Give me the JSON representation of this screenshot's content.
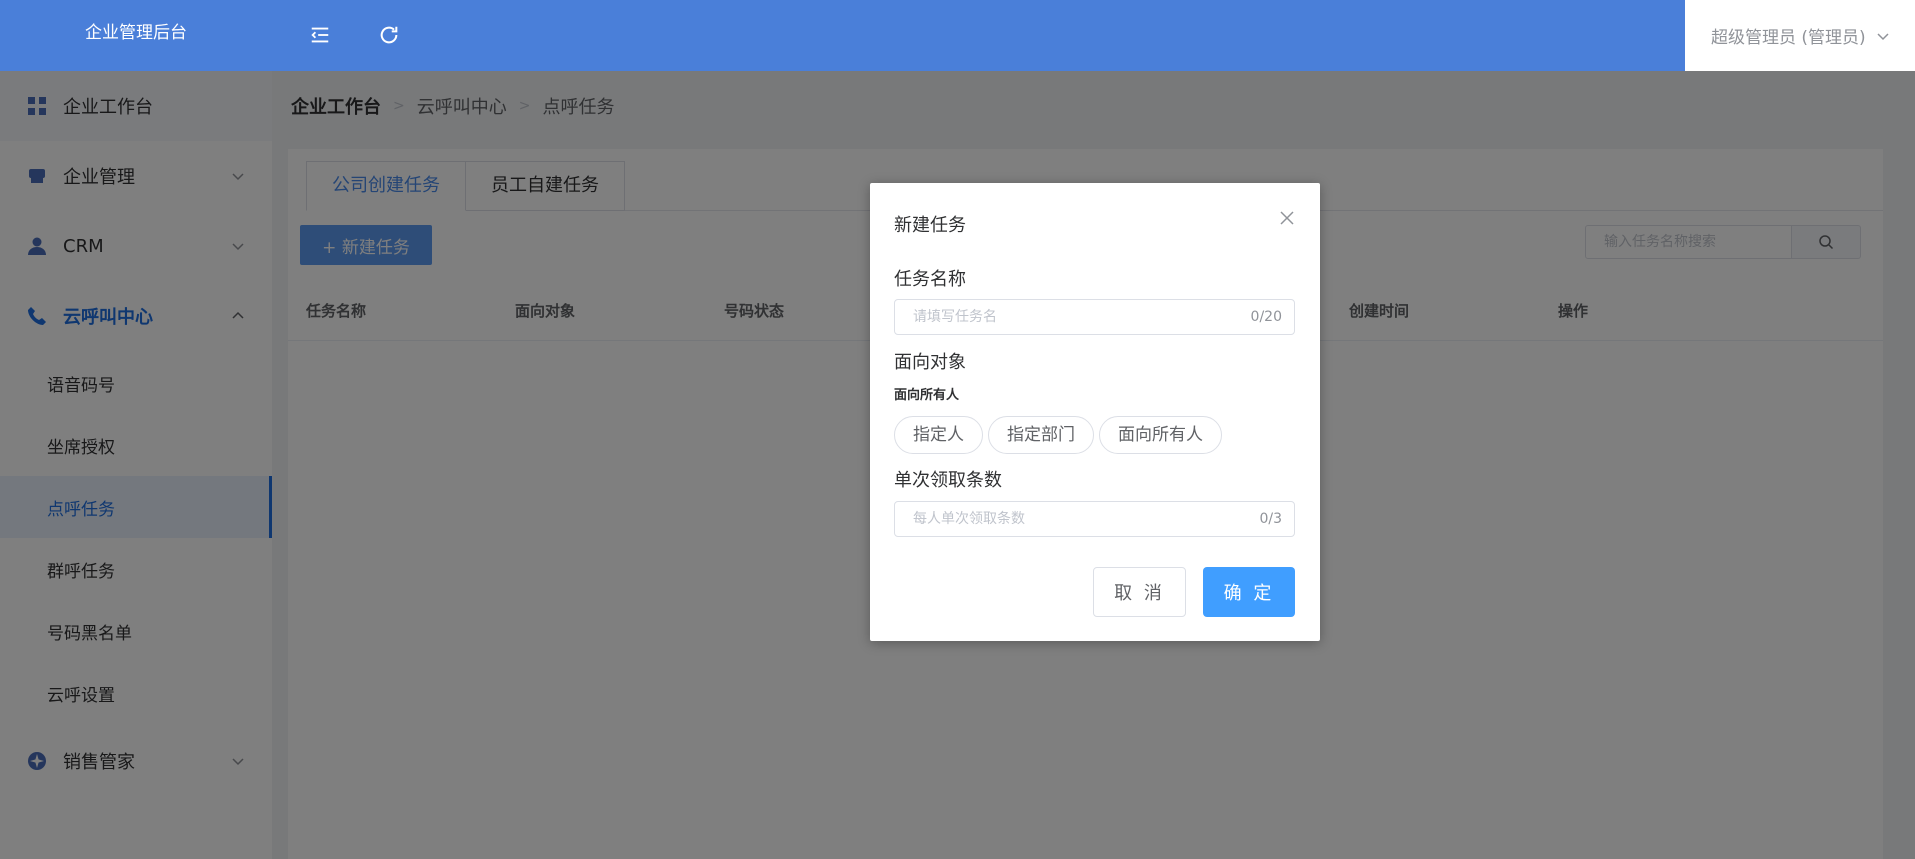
{
  "app": {
    "title": "企业管理后台"
  },
  "header": {
    "user": "超级管理员 (管理员)"
  },
  "sidebar": {
    "items": [
      {
        "label": "企业工作台",
        "icon": "grid-icon"
      },
      {
        "label": "企业管理",
        "icon": "store-icon"
      },
      {
        "label": "CRM",
        "icon": "user-icon"
      },
      {
        "label": "云呼叫中心",
        "icon": "phone-icon"
      },
      {
        "label": "销售管家",
        "icon": "compass-icon"
      }
    ],
    "sub_items": [
      "语音码号",
      "坐席授权",
      "点呼任务",
      "群呼任务",
      "号码黑名单",
      "云呼设置"
    ]
  },
  "breadcrumb": [
    "企业工作台",
    "云呼叫中心",
    "点呼任务"
  ],
  "tabs": [
    "公司创建任务",
    "员工自建任务"
  ],
  "toolbar": {
    "new_label": "+ 新建任务",
    "search_placeholder": "输入任务名称搜索"
  },
  "table": {
    "columns": [
      "任务名称",
      "面向对象",
      "号码状态",
      "创建时间",
      "操作"
    ]
  },
  "dialog": {
    "title": "新建任务",
    "name_label": "任务名称",
    "name_placeholder": "请填写任务名",
    "name_count": "0/20",
    "target_label": "面向对象",
    "target_selected": "面向所有人",
    "target_options": [
      "指定人",
      "指定部门",
      "面向所有人"
    ],
    "limit_label": "单次领取条数",
    "limit_placeholder": "每人单次领取条数",
    "limit_count": "0/3",
    "cancel": "取 消",
    "ok": "确 定"
  },
  "colors": {
    "header": "#4a7fd9",
    "accent": "#1f6fe0",
    "primary": "#409eff"
  }
}
